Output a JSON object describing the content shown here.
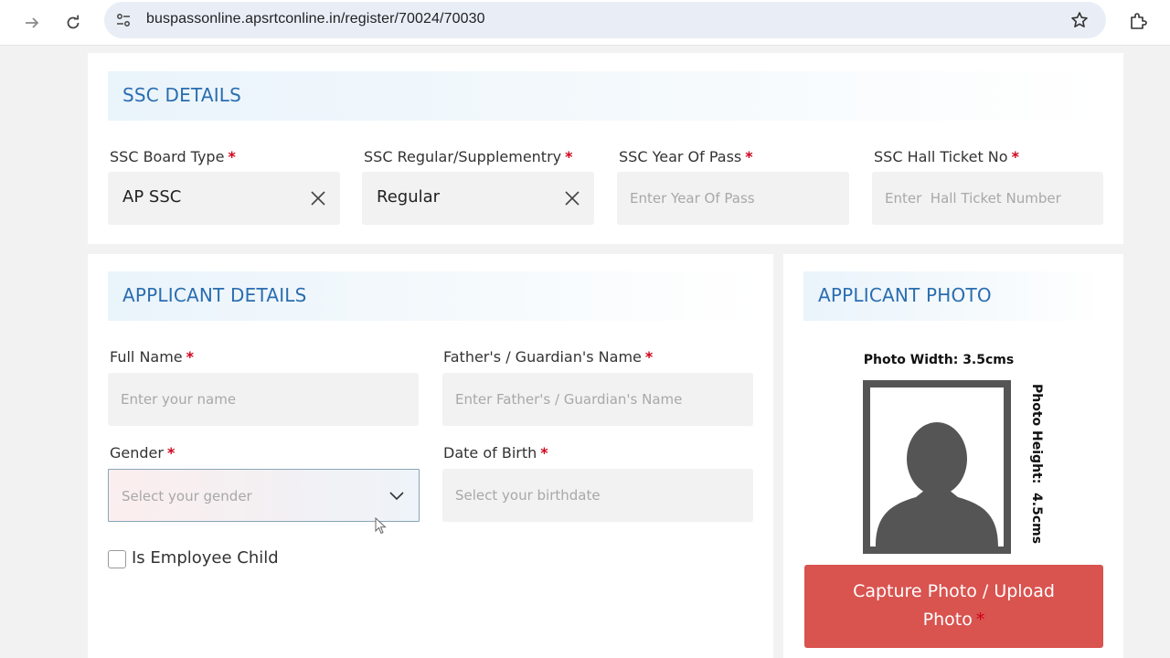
{
  "browser": {
    "url": "buspassonline.apsrtconline.in/register/70024/70030"
  },
  "ssc": {
    "heading": "SSC DETAILS",
    "board_type": {
      "label": "SSC Board Type",
      "value": "AP SSC"
    },
    "regular_supp": {
      "label": "SSC Regular/Supplementry",
      "value": "Regular"
    },
    "year_of_pass": {
      "label": "SSC Year Of Pass",
      "placeholder": "Enter Year Of Pass"
    },
    "hall_ticket": {
      "label": "SSC Hall Ticket No",
      "placeholder": "Enter  Hall Ticket Number"
    },
    "required_mark": "*"
  },
  "applicant": {
    "heading": "APPLICANT DETAILS",
    "full_name": {
      "label": "Full Name",
      "placeholder": "Enter your name"
    },
    "father_name": {
      "label": "Father's / Guardian's Name",
      "placeholder": "Enter Father's / Guardian's Name"
    },
    "gender": {
      "label": "Gender",
      "placeholder": "Select your gender"
    },
    "dob": {
      "label": "Date of Birth",
      "placeholder": "Select your birthdate"
    },
    "employee_child": {
      "label": "Is Employee Child",
      "checked": false
    },
    "required_mark": "*"
  },
  "photo": {
    "heading": "APPLICANT PHOTO",
    "width_text": "Photo Width: 3.5cms",
    "height_text": "Photo Height:  4.5cms",
    "button_line1": "Capture Photo / Upload",
    "button_line2": "Photo",
    "required_mark": "*"
  },
  "colors": {
    "accent": "#2a6db0",
    "required": "#d0021b",
    "capture_button": "#d9534f"
  }
}
